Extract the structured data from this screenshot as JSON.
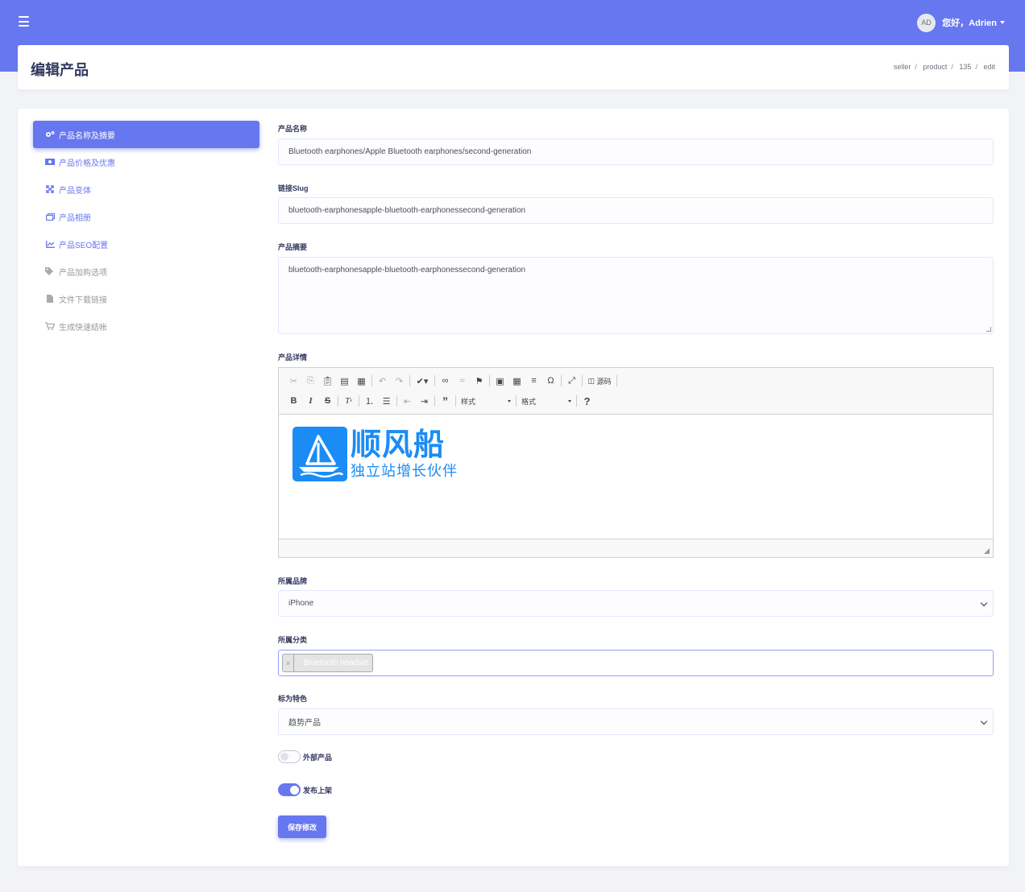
{
  "header": {
    "user_initials": "AD",
    "greeting": "您好，Adrien"
  },
  "page": {
    "title": "编辑产品",
    "breadcrumb": [
      "seller",
      "product",
      "135",
      "edit"
    ]
  },
  "nav": {
    "items": [
      {
        "label": "产品名称及摘要",
        "icon": "gears-icon"
      },
      {
        "label": "产品价格及优惠",
        "icon": "money-icon"
      },
      {
        "label": "产品变体",
        "icon": "expand-icon"
      },
      {
        "label": "产品相册",
        "icon": "images-icon"
      },
      {
        "label": "产品SEO配置",
        "icon": "chart-line-icon"
      },
      {
        "label": "产品加购选项",
        "icon": "tags-icon"
      },
      {
        "label": "文件下载链接",
        "icon": "file-icon"
      },
      {
        "label": "生成快速结帐",
        "icon": "cart-icon"
      }
    ]
  },
  "form": {
    "name_label": "产品名称",
    "name_value": "Bluetooth earphones/Apple Bluetooth earphones/second-generation",
    "slug_label": "链接Slug",
    "slug_value": "bluetooth-earphonesapple-bluetooth-earphonessecond-generation",
    "summary_label": "产品摘要",
    "summary_value": "bluetooth-earphonesapple-bluetooth-earphonessecond-generation",
    "detail_label": "产品详情",
    "editor": {
      "source_label": "源码",
      "styles_combo": "样式",
      "format_combo": "格式",
      "logo_title": "顺风船",
      "logo_subtitle": "独立站增长伙伴"
    },
    "brand_label": "所属品牌",
    "brand_value": "iPhone",
    "category_label": "所属分类",
    "category_tag": "Bluetooth headset",
    "feature_label": "标为特色",
    "feature_value": "趋势产品",
    "external_label": "外部产品",
    "external_on": false,
    "publish_label": "发布上架",
    "publish_on": true,
    "save_label": "保存修改"
  },
  "colors": {
    "accent": "#6777ef",
    "logo_blue": "#1b8cf5"
  }
}
